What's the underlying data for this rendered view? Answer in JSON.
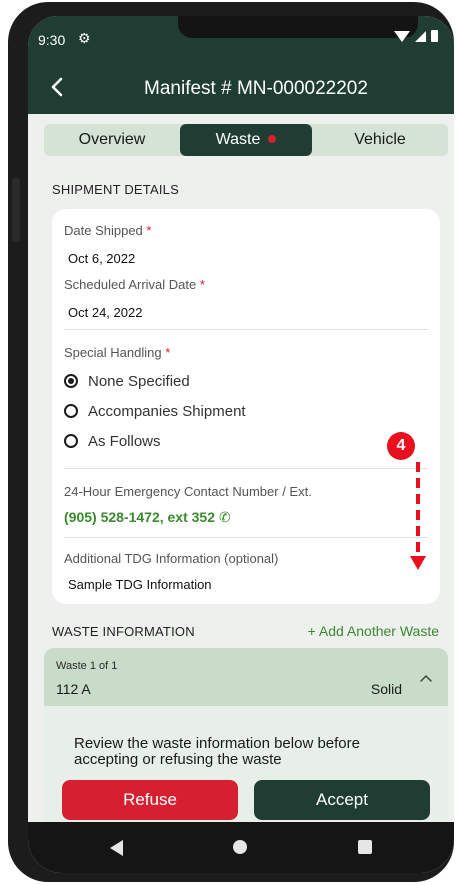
{
  "status_bar": {
    "time": "9:30",
    "settings_icon": "gear-icon"
  },
  "app_bar": {
    "title": "Manifest # MN-000022202",
    "back_icon": "arrow-left-icon"
  },
  "tabs": [
    {
      "label": "Overview",
      "selected": false
    },
    {
      "label": "Waste",
      "selected": true,
      "has_alert": true
    },
    {
      "label": "Vehicle",
      "selected": false
    }
  ],
  "shipment": {
    "section_title": "SHIPMENT DETAILS",
    "date_shipped_label": "Date Shipped",
    "date_shipped": "Oct 6, 2022",
    "arrival_label": "Scheduled Arrival Date",
    "arrival_date": "Oct 24, 2022",
    "required_marker": "*",
    "special_handling_label": "Special Handling",
    "special_handling_options": [
      {
        "label": "None Specified",
        "checked": true
      },
      {
        "label": "Accompanies Shipment",
        "checked": false
      },
      {
        "label": "As Follows",
        "checked": false
      }
    ],
    "emergency_label": "24-Hour Emergency Contact Number / Ext.",
    "emergency_number": "(905) 528-1472, ext 352",
    "emergency_icon": "phone-call-icon",
    "tdg_label": "Additional TDG Information (optional)",
    "tdg_value": "Sample TDG Information"
  },
  "annotation": {
    "step": "4"
  },
  "waste": {
    "section_title": "WASTE INFORMATION",
    "add_label": "+ Add Another Waste",
    "count_label": "Waste 1 of 1",
    "code": "112 A",
    "type": "Solid",
    "review_text": "Review the waste information below before accepting or refusing the waste",
    "refuse_label": "Refuse",
    "accept_label": "Accept"
  },
  "colors": {
    "primary": "#1f3d33",
    "accent_green": "#3a8a2e",
    "danger": "#d6202f",
    "tab_bg": "#d5e3d6"
  }
}
